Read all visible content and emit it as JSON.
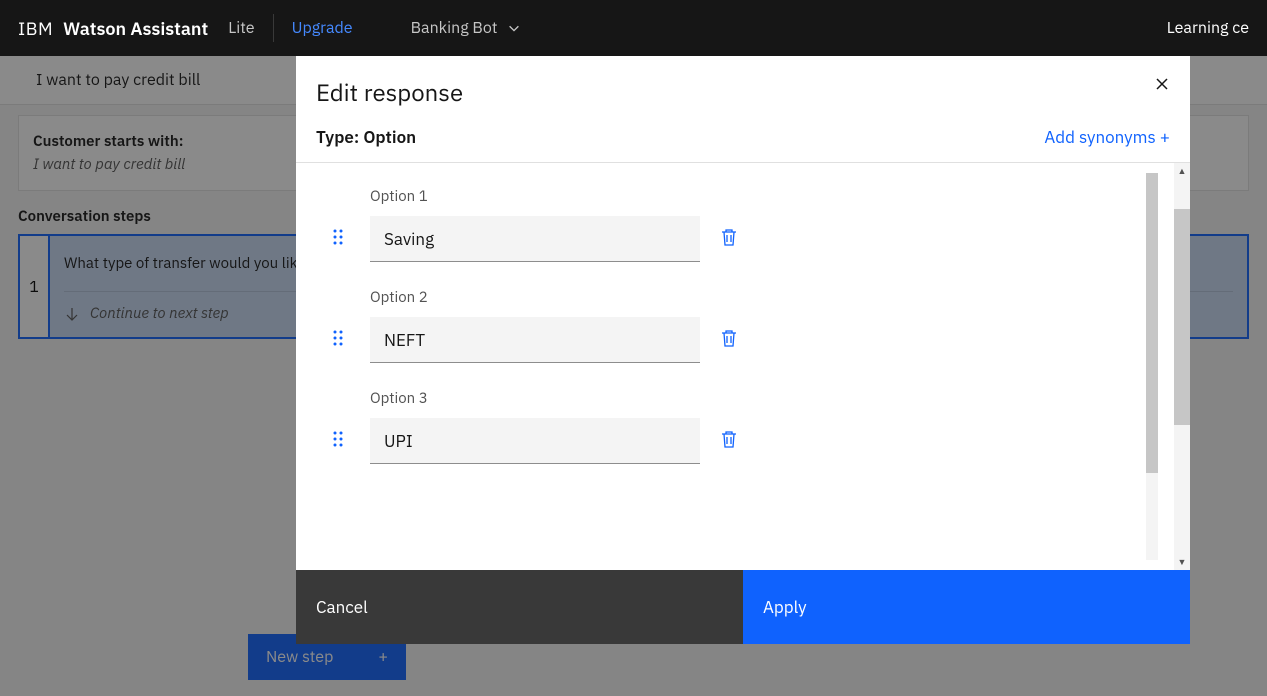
{
  "header": {
    "brand_prefix": "IBM",
    "brand_name": "Watson Assistant",
    "plan": "Lite",
    "upgrade": "Upgrade",
    "bot_name": "Banking Bot",
    "learning": "Learning ce"
  },
  "background": {
    "action_title": "I want to pay credit bill",
    "customer_label": "Customer starts with:",
    "customer_text": "I want to pay credit bill",
    "conv_steps": "Conversation steps",
    "step1_num": "1",
    "step1_text": "What type of transfer would you like",
    "continue_text": "Continue to next step",
    "new_step": "New step"
  },
  "modal": {
    "title": "Edit response",
    "type_label": "Type: Option",
    "add_synonyms": "Add synonyms +",
    "options": [
      {
        "label": "Option 1",
        "value": "Saving"
      },
      {
        "label": "Option 2",
        "value": "NEFT"
      },
      {
        "label": "Option 3",
        "value": "UPI"
      }
    ],
    "cancel": "Cancel",
    "apply": "Apply"
  }
}
